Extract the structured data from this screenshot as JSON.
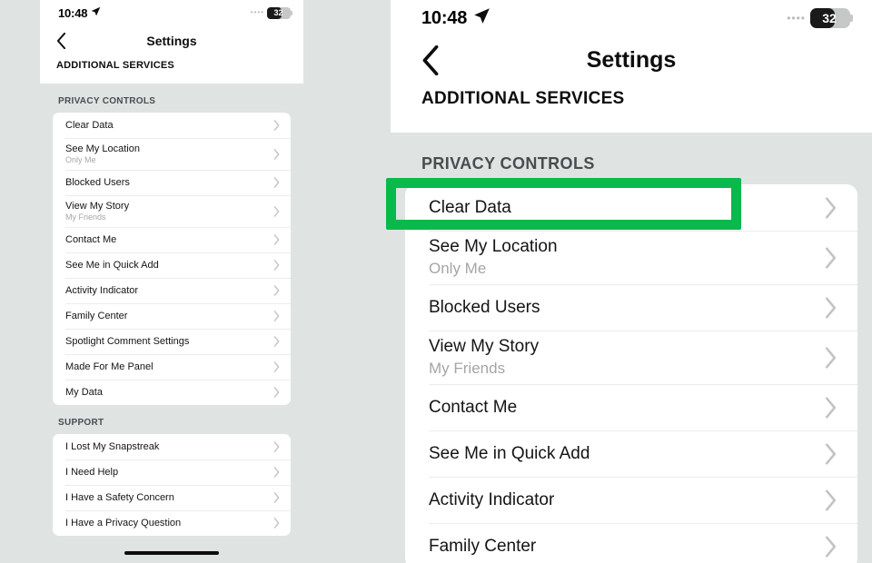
{
  "meta": {
    "accent_green": "#0ab84e",
    "page_background": "#dfe3e2",
    "card_background": "#ffffff"
  },
  "status_bar": {
    "time": "10:48",
    "location_icon": "location-arrow-icon",
    "signal_dots": "••••",
    "battery_level": "32"
  },
  "nav": {
    "back_icon": "back-chevron-icon",
    "title": "Settings"
  },
  "sub_header": "ADDITIONAL SERVICES",
  "sections": [
    {
      "title": "PRIVACY CONTROLS",
      "items": [
        {
          "label": "Clear Data",
          "sub": null,
          "highlighted": true
        },
        {
          "label": "See My Location",
          "sub": "Only Me",
          "highlighted": false
        },
        {
          "label": "Blocked Users",
          "sub": null,
          "highlighted": false
        },
        {
          "label": "View My Story",
          "sub": "My Friends",
          "highlighted": false
        },
        {
          "label": "Contact Me",
          "sub": null,
          "highlighted": false
        },
        {
          "label": "See Me in Quick Add",
          "sub": null,
          "highlighted": false
        },
        {
          "label": "Activity Indicator",
          "sub": null,
          "highlighted": false
        },
        {
          "label": "Family Center",
          "sub": null,
          "highlighted": false
        },
        {
          "label": "Spotlight Comment Settings",
          "sub": null,
          "highlighted": false
        },
        {
          "label": "Made For Me Panel",
          "sub": null,
          "highlighted": false
        },
        {
          "label": "My Data",
          "sub": null,
          "highlighted": false
        }
      ]
    },
    {
      "title": "SUPPORT",
      "items": [
        {
          "label": "I Lost My Snapstreak",
          "sub": null,
          "highlighted": false
        },
        {
          "label": "I Need Help",
          "sub": null,
          "highlighted": false
        },
        {
          "label": "I Have a Safety Concern",
          "sub": null,
          "highlighted": false
        },
        {
          "label": "I Have a Privacy Question",
          "sub": null,
          "highlighted": false
        }
      ]
    }
  ],
  "right_panel": {
    "visible_section_title": "PRIVACY CONTROLS",
    "visible_item_count": 8
  },
  "icons": {
    "row_chevron": "chevron-right-icon",
    "home_indicator": "home-indicator-bar"
  }
}
